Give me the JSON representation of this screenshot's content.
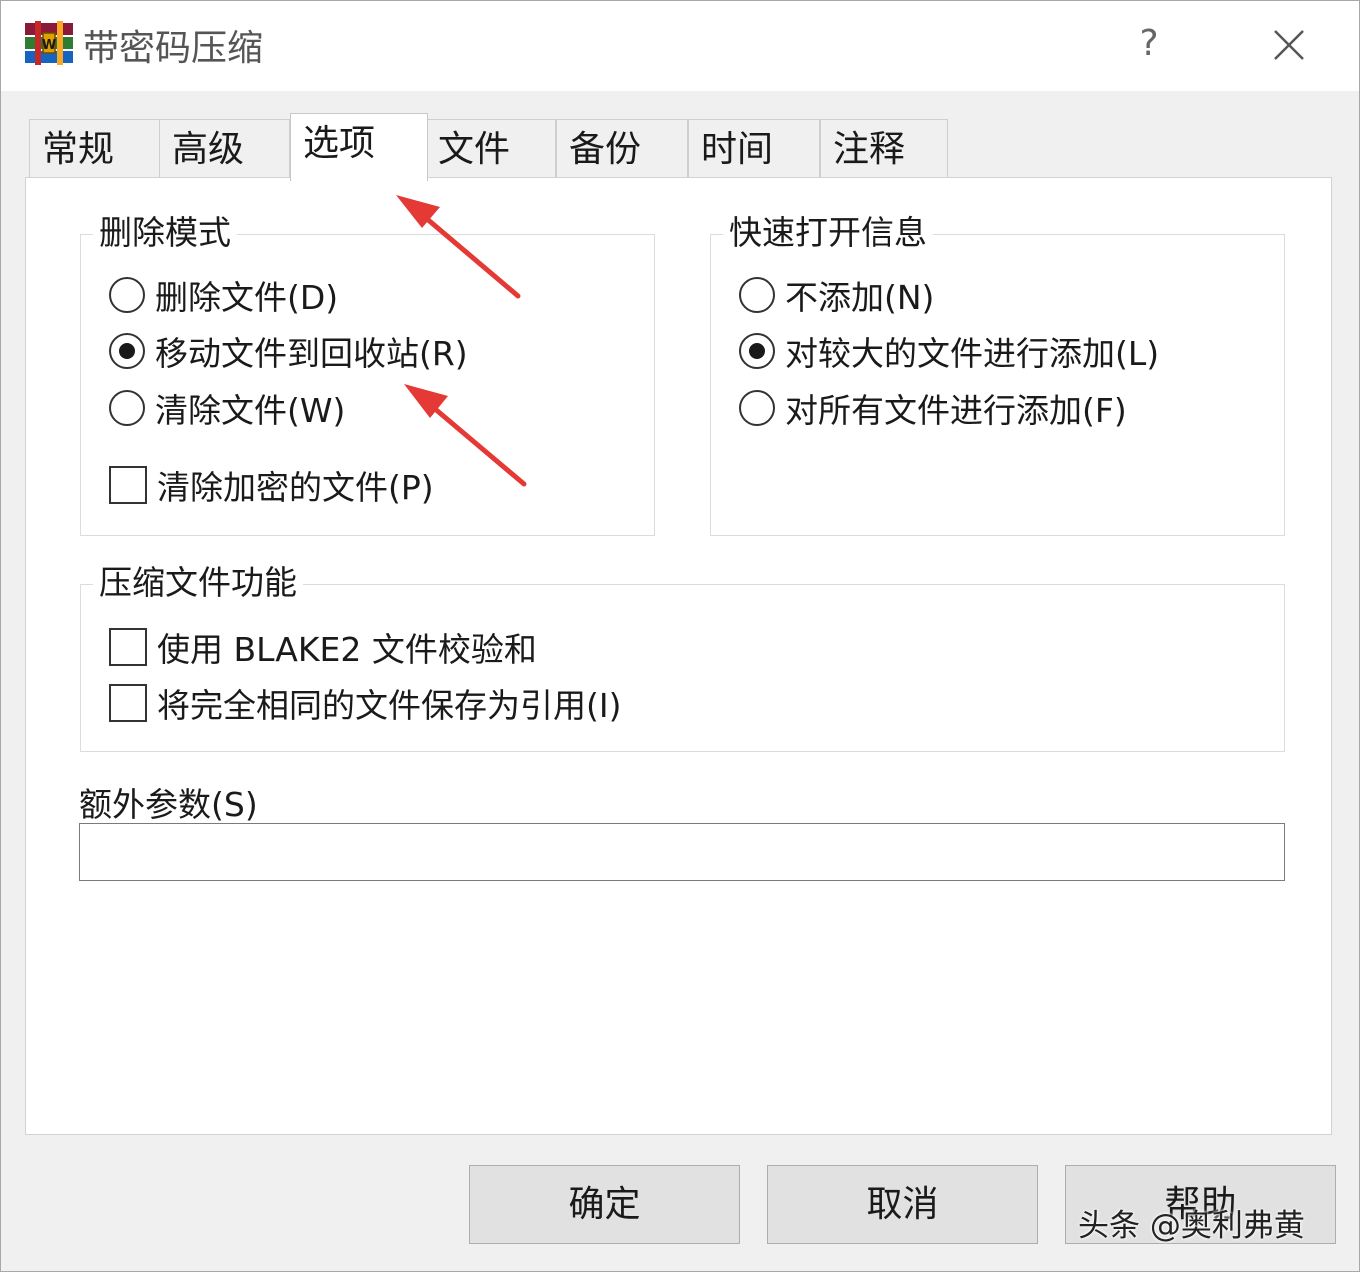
{
  "window": {
    "title": "带密码压缩",
    "help_glyph": "?"
  },
  "tabs": [
    {
      "label": "常规",
      "active": false
    },
    {
      "label": "高级",
      "active": false
    },
    {
      "label": "选项",
      "active": true
    },
    {
      "label": "文件",
      "active": false
    },
    {
      "label": "备份",
      "active": false
    },
    {
      "label": "时间",
      "active": false
    },
    {
      "label": "注释",
      "active": false
    }
  ],
  "delete_mode": {
    "title": "删除模式",
    "options": [
      {
        "label": "删除文件(D)",
        "selected": false
      },
      {
        "label": "移动文件到回收站(R)",
        "selected": true
      },
      {
        "label": "清除文件(W)",
        "selected": false
      }
    ],
    "wipe_encrypted": {
      "label": "清除加密的文件(P)",
      "checked": false
    }
  },
  "quick_open": {
    "title": "快速打开信息",
    "options": [
      {
        "label": "不添加(N)",
        "selected": false
      },
      {
        "label": "对较大的文件进行添加(L)",
        "selected": true
      },
      {
        "label": "对所有文件进行添加(F)",
        "selected": false
      }
    ]
  },
  "compression_features": {
    "title": "压缩文件功能",
    "blake2": {
      "label": "使用 BLAKE2 文件校验和",
      "checked": false
    },
    "identical_refs": {
      "label": "将完全相同的文件保存为引用(I)",
      "checked": false
    }
  },
  "extra_params": {
    "label": "额外参数(S)",
    "value": ""
  },
  "buttons": {
    "ok": "确定",
    "cancel": "取消",
    "help": "帮助"
  },
  "watermark": "头条 @奥利弗黄",
  "colors": {
    "annotation_arrow": "#e53935"
  }
}
